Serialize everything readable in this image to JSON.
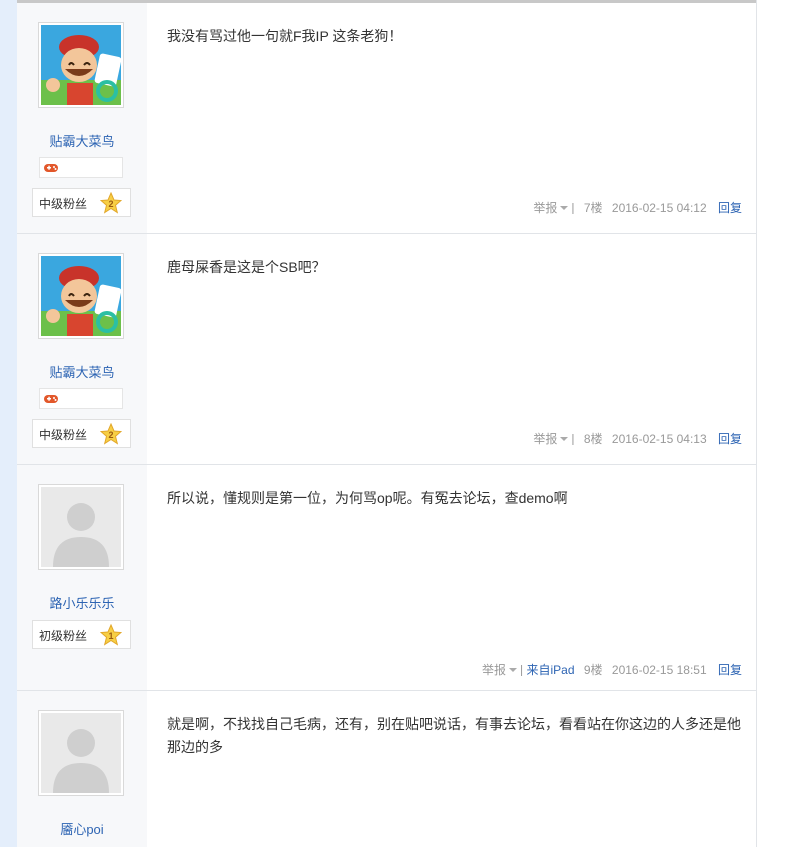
{
  "posts": [
    {
      "username": "贴霸大菜鸟",
      "avatar": "cartoon-character-avatar",
      "has_game_badge": true,
      "level_name": "中级粉丝",
      "level_number": "2",
      "content": "我没有骂过他一句就F我IP 这条老狗！",
      "report_label": "举报",
      "separator": "|",
      "device": "",
      "floor": "7楼",
      "time": "2016-02-15 04:12",
      "reply_label": "回复"
    },
    {
      "username": "贴霸大菜鸟",
      "avatar": "cartoon-character-avatar",
      "has_game_badge": true,
      "level_name": "中级粉丝",
      "level_number": "2",
      "content": "鹿母屎香是这是个SB吧？",
      "report_label": "举报",
      "separator": "|",
      "device": "",
      "floor": "8楼",
      "time": "2016-02-15 04:13",
      "reply_label": "回复"
    },
    {
      "username": "路小乐乐乐",
      "avatar": "default-avatar",
      "has_game_badge": false,
      "level_name": "初级粉丝",
      "level_number": "1",
      "content": "所以说，懂规则是第一位，为何骂op呢。有冤去论坛，查demo啊",
      "report_label": "举报",
      "separator": "|",
      "device": "来自iPad",
      "floor": "9楼",
      "time": "2016-02-15 18:51",
      "reply_label": "回复"
    },
    {
      "username": "靥心poi",
      "avatar": "default-avatar",
      "has_game_badge": false,
      "level_name": "",
      "level_number": "",
      "content": "就是啊，不找找自己毛病，还有，别在贴吧说话，有事去论坛，看看站在你这边的人多还是他那边的多",
      "report_label": "",
      "separator": "",
      "device": "",
      "floor": "",
      "time": "",
      "reply_label": ""
    }
  ],
  "colors": {
    "link": "#2d64b3",
    "meta": "#999999",
    "sidebar_bg": "#f7f8fa",
    "star": "#f5c842"
  }
}
